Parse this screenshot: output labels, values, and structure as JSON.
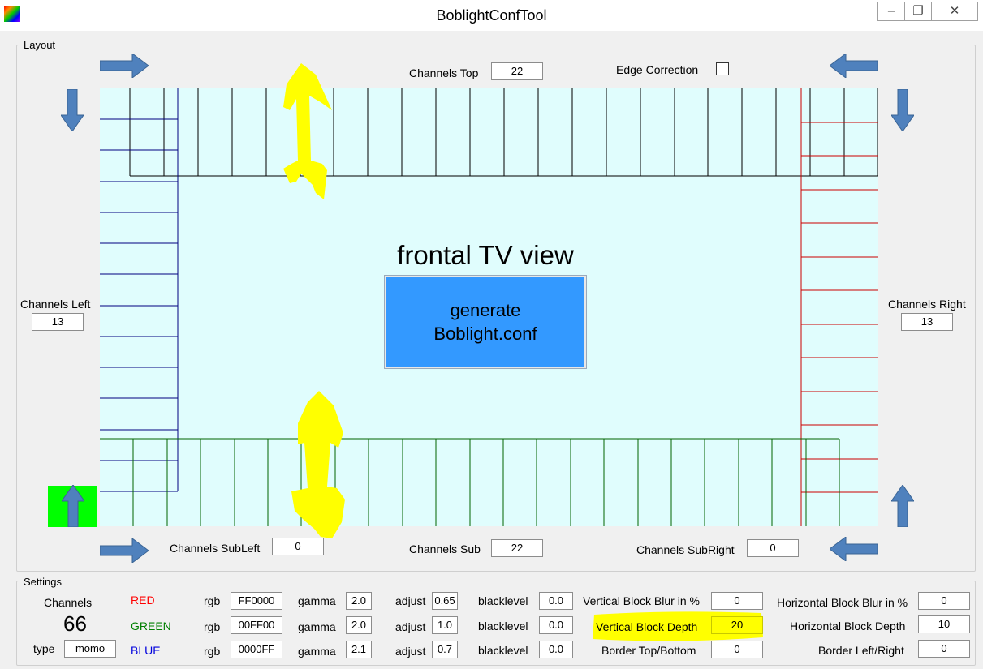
{
  "window": {
    "title": "BoblightConfTool",
    "minimize_glyph": "‒",
    "maximize_glyph": "❐",
    "close_glyph": "✕"
  },
  "layout": {
    "group_label": "Layout",
    "channels_top_label": "Channels Top",
    "channels_top_value": "22",
    "edge_correction_label": "Edge Correction",
    "edge_correction_checked": false,
    "channels_left_label": "Channels Left",
    "channels_left_value": "13",
    "channels_right_label": "Channels Right",
    "channels_right_value": "13",
    "channels_subleft_label": "Channels SubLeft",
    "channels_subleft_value": "0",
    "channels_sub_label": "Channels Sub",
    "channels_sub_value": "22",
    "channels_subright_label": "Channels SubRight",
    "channels_subright_value": "0",
    "tv_view_label": "frontal TV view",
    "generate_button_line1": "generate",
    "generate_button_line2": "Boblight.conf"
  },
  "settings": {
    "group_label": "Settings",
    "channels_label": "Channels",
    "channels_count": "66",
    "type_label": "type",
    "type_value": "momo",
    "colors": [
      {
        "name": "RED",
        "rgb_label": "rgb",
        "rgb": "FF0000",
        "gamma_label": "gamma",
        "gamma": "2.0",
        "adjust_label": "adjust",
        "adjust": "0.65",
        "blacklevel_label": "blacklevel",
        "blacklevel": "0.0"
      },
      {
        "name": "GREEN",
        "rgb_label": "rgb",
        "rgb": "00FF00",
        "gamma_label": "gamma",
        "gamma": "2.0",
        "adjust_label": "adjust",
        "adjust": "1.0",
        "blacklevel_label": "blacklevel",
        "blacklevel": "0.0"
      },
      {
        "name": "BLUE",
        "rgb_label": "rgb",
        "rgb": "0000FF",
        "gamma_label": "gamma",
        "gamma": "2.1",
        "adjust_label": "adjust",
        "adjust": "0.7",
        "blacklevel_label": "blacklevel",
        "blacklevel": "0.0"
      }
    ],
    "vertical_blur_label": "Vertical Block Blur in %",
    "vertical_blur_value": "0",
    "vertical_depth_label": "Vertical Block Depth",
    "vertical_depth_value": "20",
    "border_tb_label": "Border Top/Bottom",
    "border_tb_value": "0",
    "horizontal_blur_label": "Horizontal Block Blur in %",
    "horizontal_blur_value": "0",
    "horizontal_depth_label": "Horizontal Block Depth",
    "horizontal_depth_value": "10",
    "border_lr_label": "Border Left/Right",
    "border_lr_value": "0"
  },
  "colors": {
    "canvas_bg": "#e0fdfd",
    "top_lines": "#000000",
    "left_lines": "#000080",
    "right_lines": "#cc0000",
    "bottom_lines": "#006400",
    "arrow_blue": "#4f81bd",
    "annotation_yellow": "#ffff00",
    "button_blue": "#3399ff",
    "selected_green": "#00ff00"
  },
  "icons": {
    "arrows": [
      "arrow-right-icon",
      "arrow-down-icon",
      "arrow-left-icon",
      "arrow-up-icon"
    ],
    "annotations": [
      "double-headed-arrow-icon"
    ]
  }
}
